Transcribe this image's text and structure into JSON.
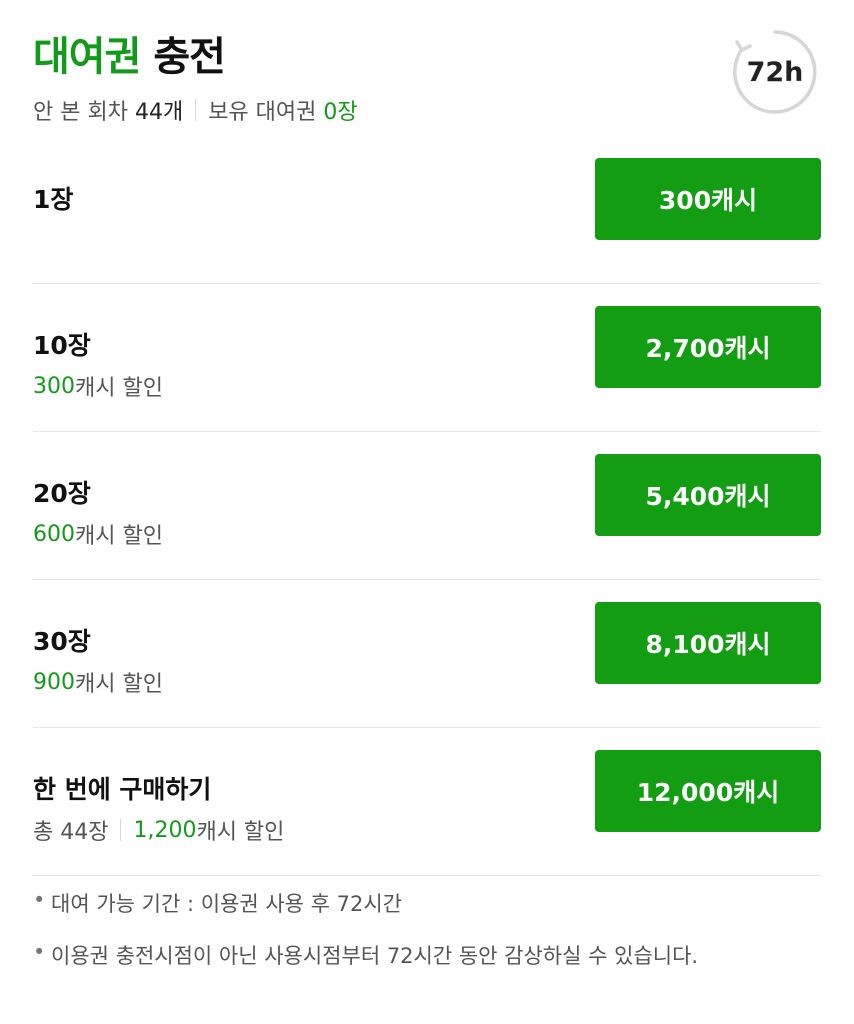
{
  "header": {
    "title_accent": "대여권",
    "title_rest": "충전",
    "unread_label": "안 본 회차",
    "unread_count": "44개",
    "owned_label": "보유 대여권",
    "owned_count": "0장",
    "clock_label": "72h"
  },
  "options": [
    {
      "label": "1장",
      "price": "300캐시"
    },
    {
      "label": "10장",
      "discount_amount": "300",
      "discount_suffix": "캐시 할인",
      "price": "2,700캐시"
    },
    {
      "label": "20장",
      "discount_amount": "600",
      "discount_suffix": "캐시 할인",
      "price": "5,400캐시"
    },
    {
      "label": "30장",
      "discount_amount": "900",
      "discount_suffix": "캐시 할인",
      "price": "8,100캐시"
    },
    {
      "label": "한 번에 구매하기",
      "total": "총 44장",
      "discount_amount": "1,200",
      "discount_suffix": "캐시 할인",
      "price": "12,000캐시"
    }
  ],
  "notes": {
    "bullet": "•",
    "items": [
      "대여 가능 기간 : 이용권 사용 후 72시간",
      "이용권 충전시점이 아닌 사용시점부터 72시간 동안 감상하실 수 있습니다."
    ]
  },
  "colors": {
    "accent_green": "#149a1a",
    "button_green": "#129d12",
    "divider": "#e6e6e6"
  }
}
